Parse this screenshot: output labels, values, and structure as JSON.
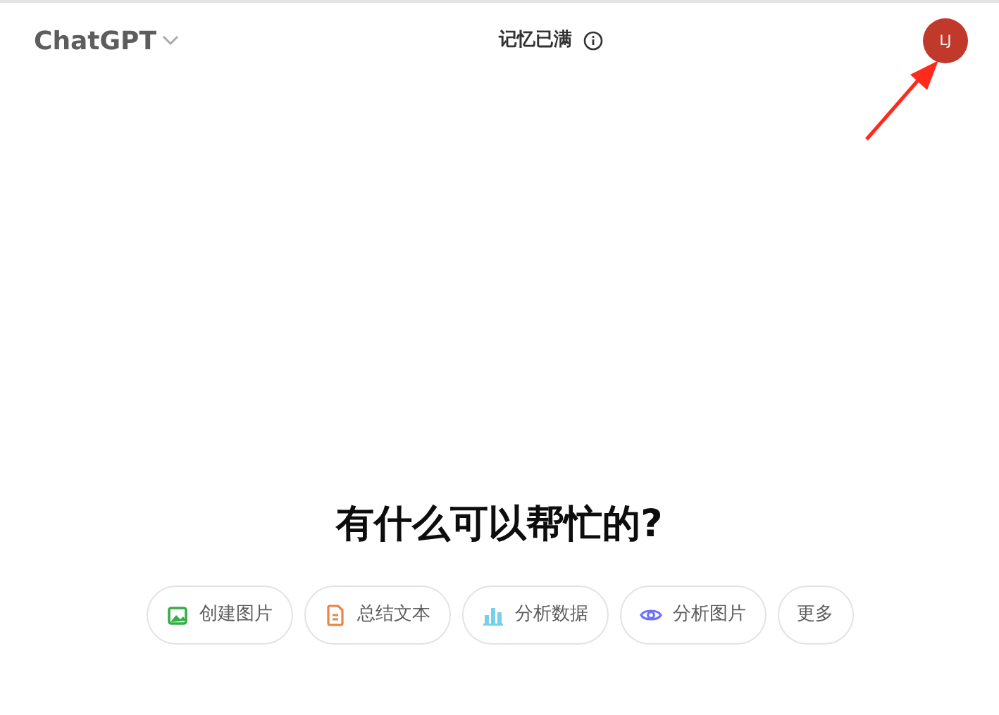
{
  "header": {
    "model": "ChatGPT",
    "memory_status": "记忆已满",
    "avatar": "LJ"
  },
  "headline": "有什么可以帮忙的?",
  "suggestions": [
    {
      "kind": "image",
      "label": "创建图片",
      "color": "#35ae47"
    },
    {
      "kind": "doc",
      "label": "总结文本",
      "color": "#ea8444"
    },
    {
      "kind": "chart",
      "label": "分析数据",
      "color": "#76d0eb"
    },
    {
      "kind": "eye",
      "label": "分析图片",
      "color": "#6c71ff"
    },
    {
      "kind": "text",
      "label": "更多"
    }
  ],
  "annotation": {
    "kind": "arrow",
    "color": "#ff2a1a"
  }
}
